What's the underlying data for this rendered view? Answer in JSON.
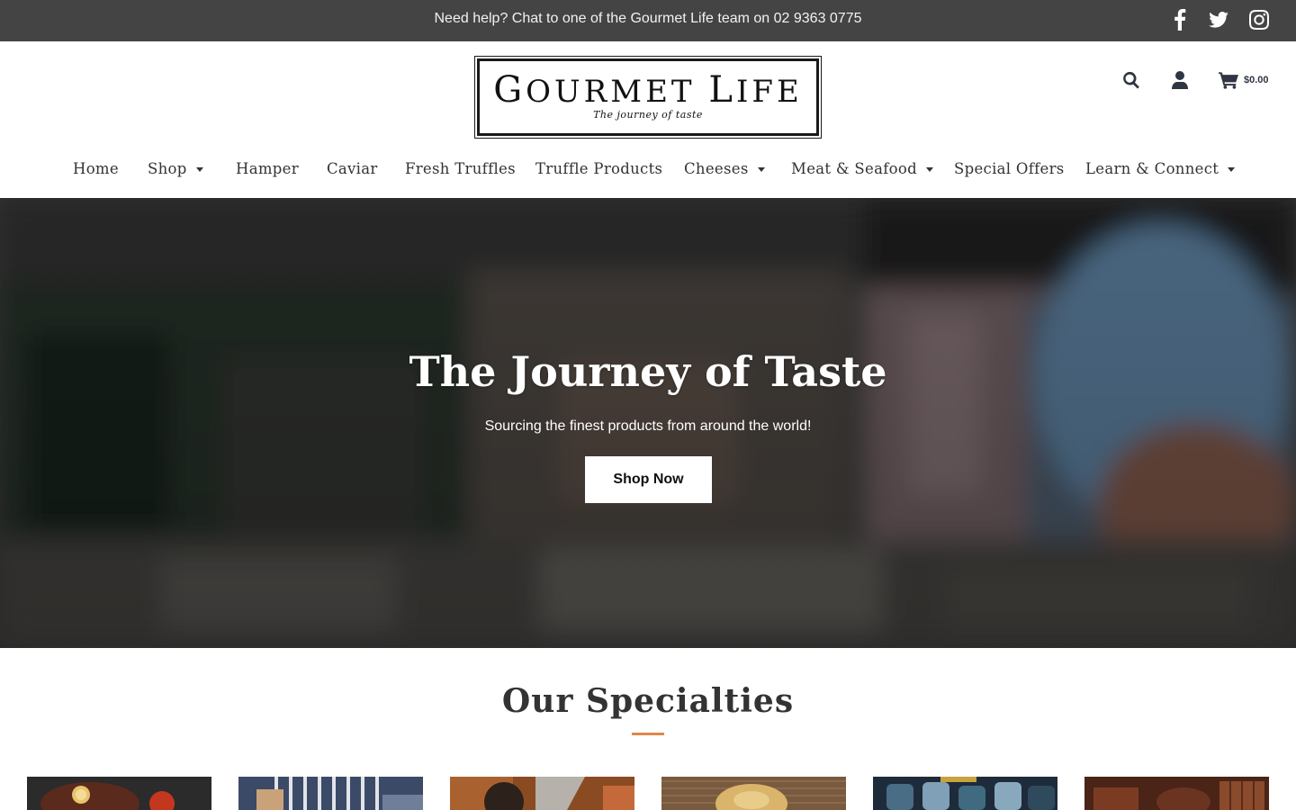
{
  "topbar": {
    "help_text": "Need help? Chat to one of the Gourmet Life team on 02 9363 0775",
    "social": [
      "facebook-icon",
      "twitter-icon",
      "instagram-icon"
    ]
  },
  "header": {
    "logo_title": "Gourmet Life",
    "logo_first_letter_1": "G",
    "logo_rest_1": "OURMET",
    "logo_first_letter_2": "L",
    "logo_rest_2": "IFE",
    "logo_tagline": "The journey of taste",
    "cart_amount": "$0.00",
    "icons": [
      "search-icon",
      "user-icon",
      "cart-icon"
    ]
  },
  "nav": {
    "items": [
      {
        "label": "Home",
        "dropdown": false
      },
      {
        "label": "Shop",
        "dropdown": true
      },
      {
        "label": "Hamper",
        "dropdown": false
      },
      {
        "label": "Caviar",
        "dropdown": false
      },
      {
        "label": "Fresh Truffles",
        "dropdown": false
      },
      {
        "label": "Truffle Products",
        "dropdown": false
      },
      {
        "label": "Cheeses",
        "dropdown": true
      },
      {
        "label": "Meat & Seafood",
        "dropdown": true
      },
      {
        "label": "Special Offers",
        "dropdown": false
      },
      {
        "label": "Learn & Connect",
        "dropdown": true
      }
    ]
  },
  "hero": {
    "title": "The Journey of Taste",
    "subtitle": "Sourcing the finest products from around the world!",
    "button_label": "Shop Now"
  },
  "specialties": {
    "title": "Our Specialties",
    "accent_color": "#e0884a"
  },
  "colors": {
    "topbar_bg": "#444444",
    "text_dark": "#333333",
    "icon_dark": "#2f3542"
  }
}
